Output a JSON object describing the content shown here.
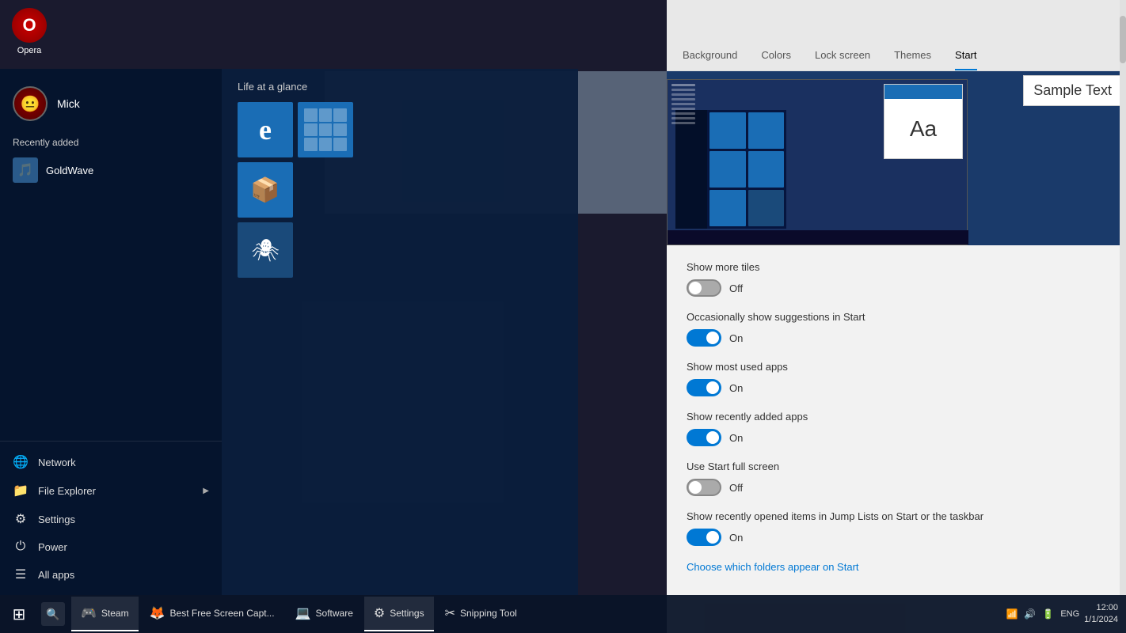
{
  "desktop": {
    "opera_label": "Opera"
  },
  "start_menu": {
    "user": {
      "name": "Mick"
    },
    "recently_added_label": "Recently added",
    "recently_added_apps": [
      {
        "name": "GoldWave"
      }
    ],
    "tiles_section": "Life at a glance",
    "tiles": [
      {
        "id": "edge",
        "label": "Edge"
      },
      {
        "id": "calc",
        "label": "Calculator"
      },
      {
        "id": "3d",
        "label": "3D Viewer"
      },
      {
        "id": "spider",
        "label": "Spider"
      }
    ],
    "nav_items": [
      {
        "id": "network",
        "label": "Network",
        "icon": "🌐"
      },
      {
        "id": "file-explorer",
        "label": "File Explorer",
        "icon": "📁",
        "has_arrow": true
      },
      {
        "id": "settings",
        "label": "Settings",
        "icon": "⚙"
      },
      {
        "id": "power",
        "label": "Power",
        "icon": "⏻"
      },
      {
        "id": "all-apps",
        "label": "All apps",
        "icon": "☰"
      }
    ]
  },
  "settings": {
    "nav_items": [
      {
        "id": "background",
        "label": "Background"
      },
      {
        "id": "colors",
        "label": "Colors"
      },
      {
        "id": "lock-screen",
        "label": "Lock screen"
      },
      {
        "id": "themes",
        "label": "Themes"
      },
      {
        "id": "start",
        "label": "Start",
        "active": true
      }
    ],
    "preview": {
      "sample_text": "Sample Text",
      "font_preview": "Aa"
    },
    "toggles": [
      {
        "id": "show-more-tiles",
        "label": "Show more tiles",
        "state": "off",
        "state_label": "Off"
      },
      {
        "id": "show-suggestions",
        "label": "Occasionally show suggestions in Start",
        "state": "on",
        "state_label": "On"
      },
      {
        "id": "show-most-used",
        "label": "Show most used apps",
        "state": "on",
        "state_label": "On"
      },
      {
        "id": "show-recently-added",
        "label": "Show recently added apps",
        "state": "on",
        "state_label": "On"
      },
      {
        "id": "full-screen",
        "label": "Use Start full screen",
        "state": "off",
        "state_label": "Off"
      },
      {
        "id": "jump-lists",
        "label": "Show recently opened items in Jump Lists on Start or the taskbar",
        "state": "on",
        "state_label": "On"
      }
    ],
    "link": {
      "label": "Choose which folders appear on Start"
    }
  },
  "taskbar": {
    "apps": [
      {
        "id": "steam",
        "label": "Steam",
        "icon": "🎮",
        "active": true
      },
      {
        "id": "screen-capture",
        "label": "Best Free Screen Capt...",
        "icon": "🦊",
        "active": false
      },
      {
        "id": "software",
        "label": "Software",
        "icon": "💻",
        "active": false
      },
      {
        "id": "settings-app",
        "label": "Settings",
        "icon": "⚙",
        "active": true
      },
      {
        "id": "snipping",
        "label": "Snipping Tool",
        "icon": "✂",
        "active": false
      }
    ],
    "systray": {
      "time": "12:00",
      "date": "1/1/2024"
    }
  }
}
